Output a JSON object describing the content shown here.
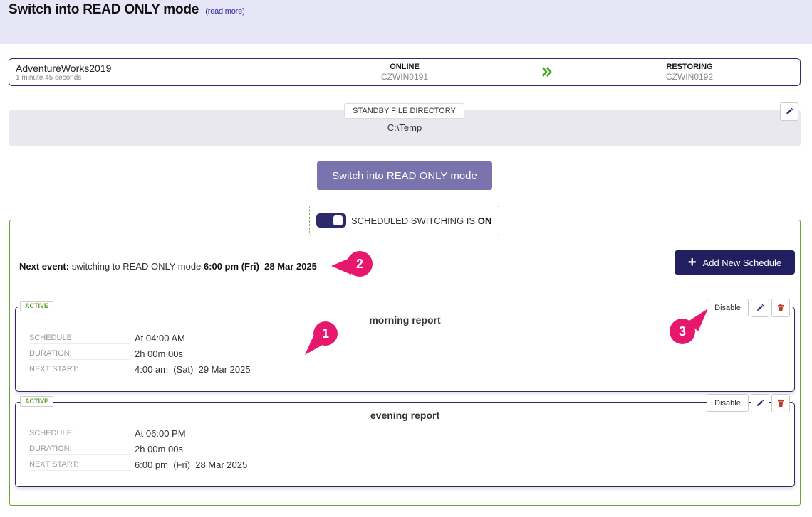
{
  "header": {
    "title": "Switch into READ ONLY mode",
    "read_more": "(read more)"
  },
  "database": {
    "name": "AdventureWorks2019",
    "duration": "1 minute 45 seconds",
    "primary": {
      "status": "ONLINE",
      "server": "CZWIN0191"
    },
    "secondary": {
      "status": "RESTORING",
      "server": "CZWIN0192"
    }
  },
  "standby": {
    "label": "STANDBY FILE DIRECTORY",
    "path": "C:\\Temp"
  },
  "switch_button": "Switch into READ ONLY mode",
  "scheduled": {
    "label": "SCHEDULED SWITCHING IS",
    "state": "ON",
    "next_event_label": "Next event:",
    "next_event_text": "switching to READ ONLY mode",
    "next_event_time": "6:00 pm",
    "next_event_date": "(Fri)  28 Mar 2025",
    "add_button": "Add New Schedule",
    "add_icon": "+"
  },
  "schedules": [
    {
      "badge": "ACTIVE",
      "title": "morning report",
      "rows": [
        {
          "label": "SCHEDULE:",
          "value": "At 04:00 AM"
        },
        {
          "label": "DURATION:",
          "value": "2h 00m 00s"
        },
        {
          "label": "NEXT START:",
          "value": "4:00 am  (Sat)  29 Mar 2025"
        }
      ],
      "disable_label": "Disable"
    },
    {
      "badge": "ACTIVE",
      "title": "evening report",
      "rows": [
        {
          "label": "SCHEDULE:",
          "value": "At 06:00 PM"
        },
        {
          "label": "DURATION:",
          "value": "2h 00m 00s"
        },
        {
          "label": "NEXT START:",
          "value": "6:00 pm  (Fri)  28 Mar 2025"
        }
      ],
      "disable_label": "Disable"
    }
  ],
  "callouts": [
    "1",
    "2",
    "3"
  ],
  "colors": {
    "accent": "#2c2a6b",
    "active_green": "#5c9e2a",
    "callout": "#e8176e",
    "delete_red": "#c0392b"
  }
}
